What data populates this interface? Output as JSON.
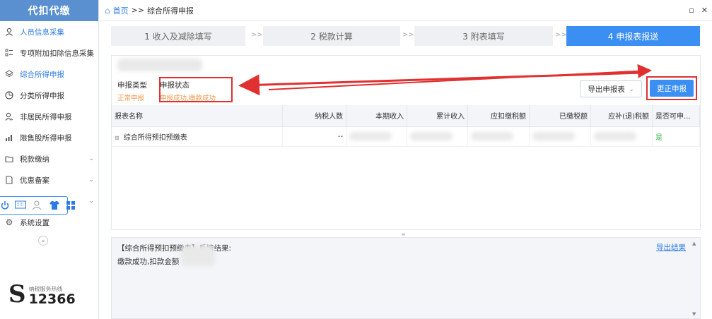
{
  "sidebar": {
    "logo": "代扣代缴",
    "items": [
      {
        "label": "人员信息采集",
        "icon": "person-icon"
      },
      {
        "label": "专项附加扣除信息采集",
        "icon": "list-icon"
      },
      {
        "label": "综合所得申报",
        "icon": "layers-icon"
      },
      {
        "label": "分类所得申报",
        "icon": "pie-icon"
      },
      {
        "label": "非居民所得申报",
        "icon": "user-outline-icon"
      },
      {
        "label": "限售股所得申报",
        "icon": "bar-chart-icon"
      },
      {
        "label": "税款缴纳",
        "icon": "folder-icon"
      },
      {
        "label": "优惠备案",
        "icon": "doc-icon"
      },
      {
        "label": "系统设置",
        "icon": "gear-icon"
      }
    ],
    "hotline_label": "纳税服务热线",
    "hotline_number": "12366"
  },
  "breadcrumb": {
    "home": "首页",
    "sep": ">>",
    "current": "综合所得申报"
  },
  "steps": [
    "1 收入及减除填写",
    "2 税款计算",
    "3 附表填写",
    "4 申报表报送"
  ],
  "step_separator": ">>",
  "info": {
    "type_label": "申报类型",
    "type_value": "正常申报",
    "status_label": "申报状态",
    "status_value": "申报成功,缴款成功"
  },
  "buttons": {
    "export": "导出申报表",
    "correct": "更正申报",
    "export_result": "导出结果"
  },
  "table": {
    "headers": [
      "报表名称",
      "纳税人数",
      "本期收入",
      "累计收入",
      "应扣缴税额",
      "已缴税额",
      "应补(退)税额",
      "是否可申..."
    ],
    "rows": [
      {
        "name": "综合所得预扣预缴表",
        "count": "--",
        "can_declare": "是"
      }
    ]
  },
  "result": {
    "line1": "【综合所得预扣预缴表】反馈结果:",
    "line2": "缴款成功,扣款金额"
  },
  "colors": {
    "accent": "#3b8ff3",
    "annotation": "#e03030",
    "status": "#f0964a",
    "yes": "#39b54a"
  }
}
